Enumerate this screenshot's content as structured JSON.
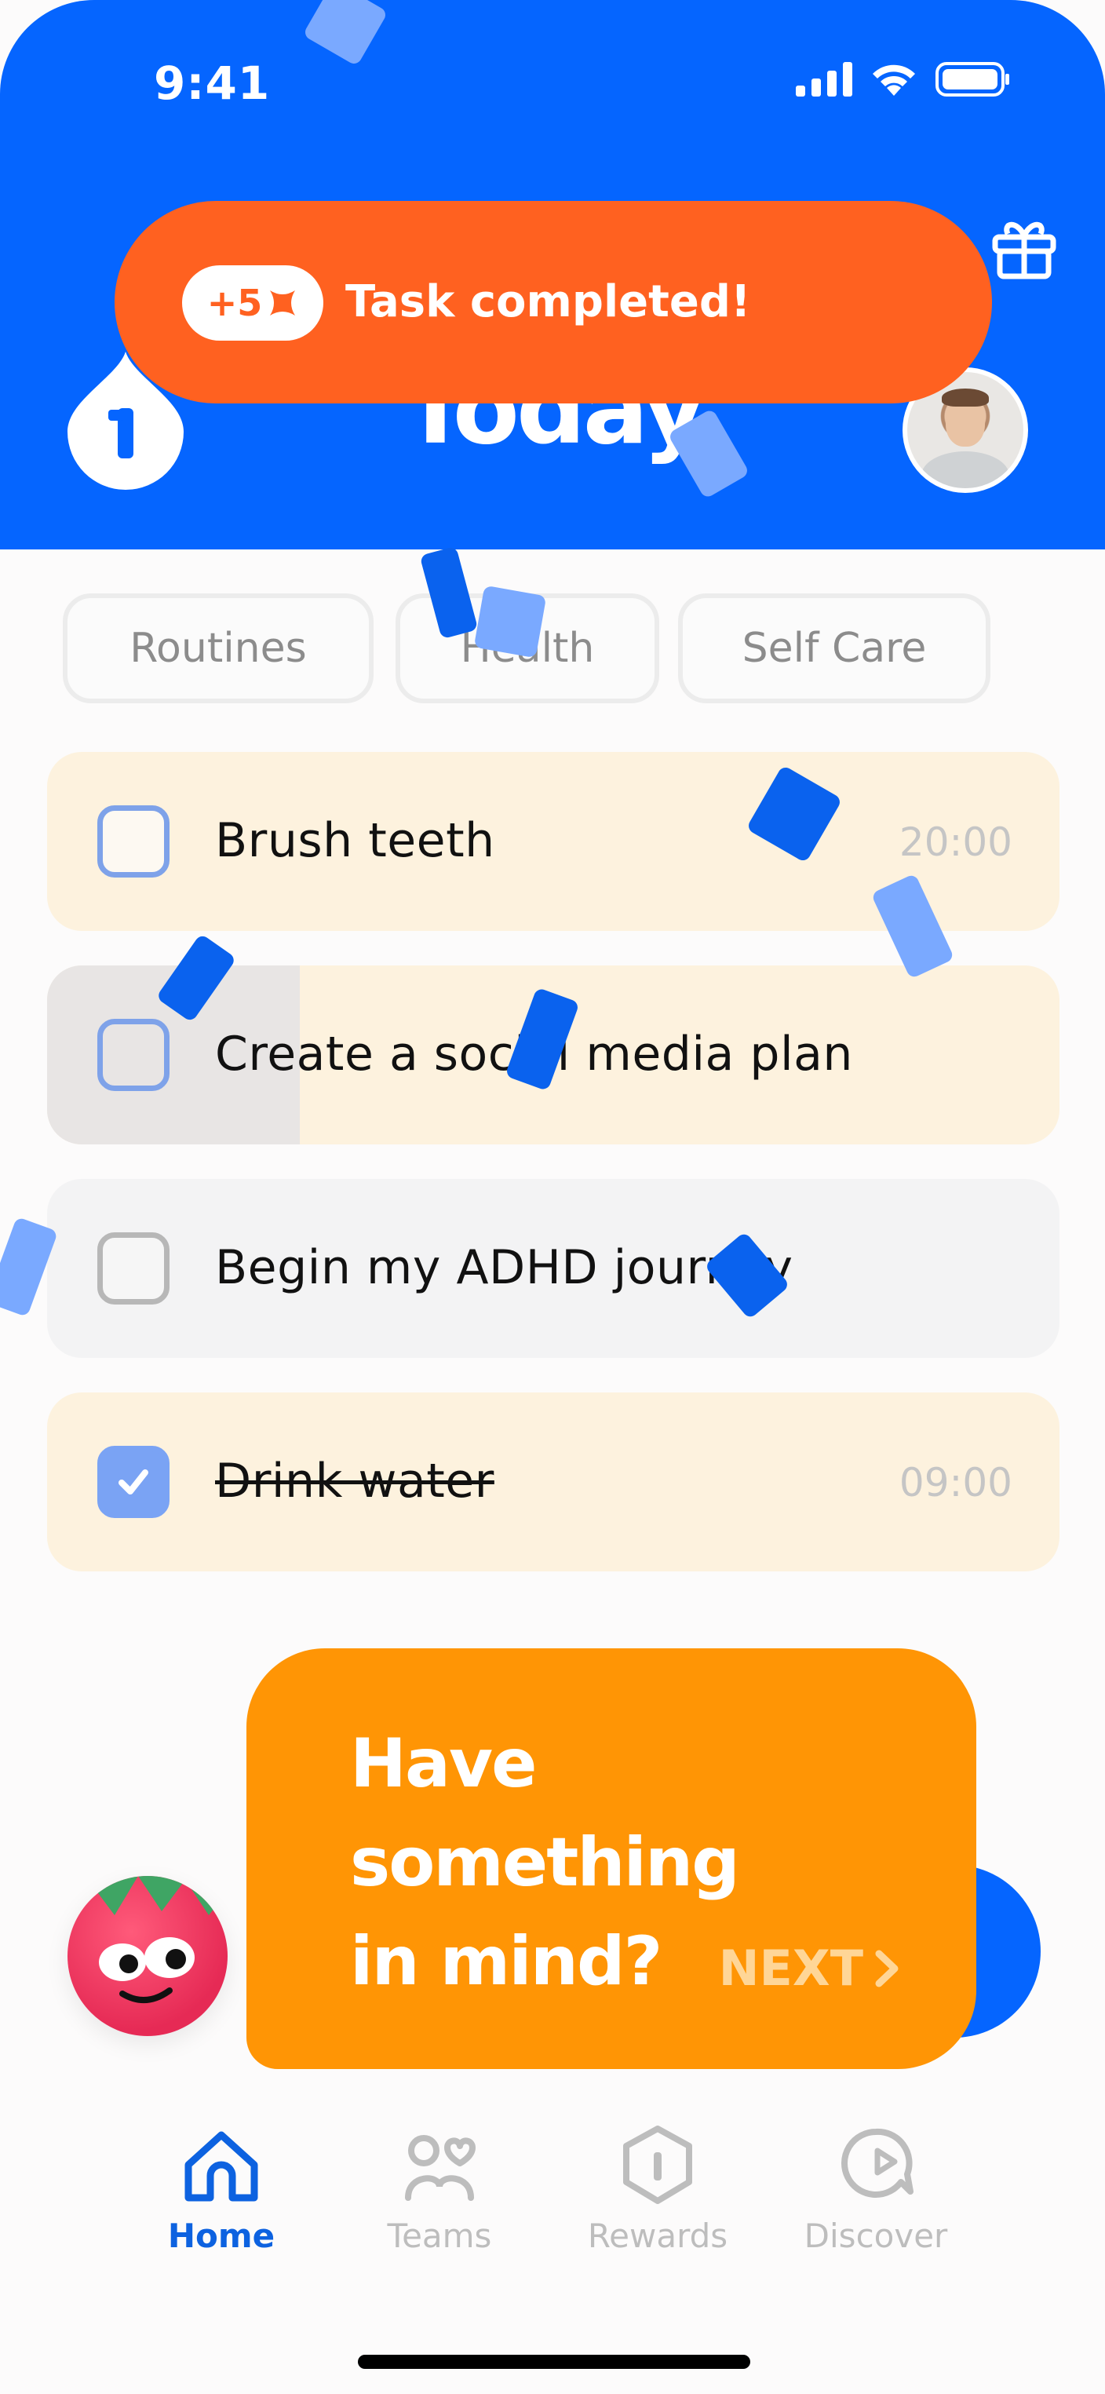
{
  "status_bar": {
    "time": "9:41"
  },
  "header": {
    "title": "Today",
    "streak_count": "1"
  },
  "toast": {
    "points": "+5",
    "message": "Task completed!"
  },
  "categories": [
    "Routines",
    "Health",
    "Self Care"
  ],
  "tasks": [
    {
      "label": "Brush teeth",
      "time": "20:00",
      "done": false
    },
    {
      "label": "Create a social media plan",
      "time": "",
      "done": false
    },
    {
      "label": "Begin my ADHD journey",
      "time": "",
      "done": false
    },
    {
      "label": "Drink water",
      "time": "09:00",
      "done": true
    }
  ],
  "bubble": {
    "text": "Have something\nin mind?",
    "next": "NEXT"
  },
  "nav": [
    {
      "label": "Home",
      "active": true,
      "icon": "home-icon"
    },
    {
      "label": "Teams",
      "active": false,
      "icon": "teams-icon"
    },
    {
      "label": "Rewards",
      "active": false,
      "icon": "rewards-icon"
    },
    {
      "label": "Discover",
      "active": false,
      "icon": "discover-icon"
    }
  ],
  "colors": {
    "header_blue": "#0565ff",
    "toast_orange": "#ff6120",
    "bubble_orange": "#ff9505",
    "task_beige": "#fdf2de",
    "check_blue": "#7aa3f4",
    "nav_active": "#0d62e0"
  }
}
